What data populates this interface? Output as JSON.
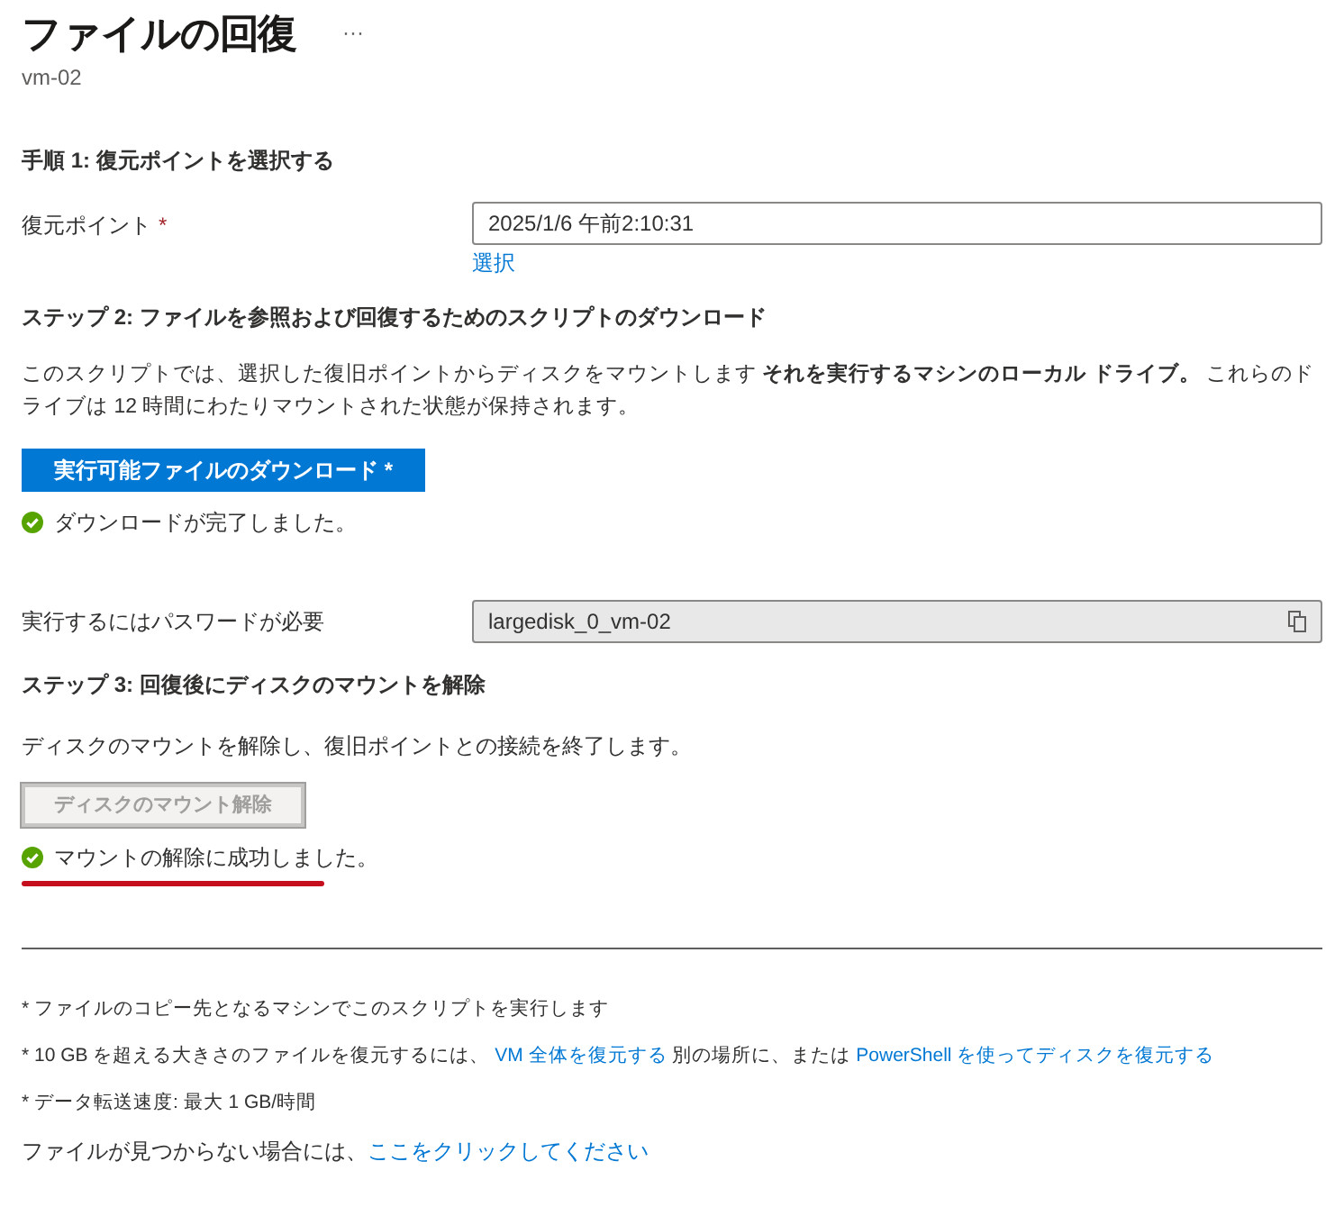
{
  "header": {
    "title": "ファイルの回復",
    "more": "···",
    "subtitle": "vm-02"
  },
  "step1": {
    "heading": "手順 1: 復元ポイントを選択する",
    "field": {
      "label": "復元ポイント",
      "required_mark": "*",
      "value": "2025/1/6 午前2:10:31",
      "link": "選択"
    }
  },
  "step2": {
    "heading": "ステップ 2: ファイルを参照および回復するためのスクリプトのダウンロード",
    "description": "このスクリプトでは、選択した復旧ポイントからディスクをマウントします **それを実行するマシンのローカル ドライブ。** これらのドライブは 12 時間にわたりマウントされた状態が保持されます。",
    "button": {
      "label": "実行可能ファイルのダウンロード *",
      "disabled": false
    },
    "status": {
      "kind": "success",
      "text": "ダウンロードが完了しました。"
    },
    "password": {
      "label": "実行するにはパスワードが必要",
      "value": "largedisk_0_vm-02",
      "read_only": true
    }
  },
  "step3": {
    "heading": "ステップ 3: 回復後にディスクのマウントを解除",
    "description": "ディスクのマウントを解除し、復旧ポイントとの接続を終了します。",
    "button": {
      "label": "ディスクのマウント解除",
      "disabled": true
    },
    "status": {
      "kind": "success",
      "text": "マウントの解除に成功しました。",
      "underlined": true
    }
  },
  "footnotes": [
    {
      "parts": [
        {
          "kind": "text",
          "text": "* ファイルのコピー先となるマシンでこのスクリプトを実行します"
        }
      ]
    },
    {
      "parts": [
        {
          "kind": "text",
          "text": "* 10 GB を超える大きさのファイルを復元するには、"
        },
        {
          "kind": "link",
          "text": "VM 全体を復元する"
        },
        {
          "kind": "text",
          "text": "別の場所に、または"
        },
        {
          "kind": "link",
          "text": "PowerShell を使ってディスクを復元する"
        }
      ]
    },
    {
      "parts": [
        {
          "kind": "text",
          "text": "* データ転送速度: 最大 1 GB/時間"
        }
      ]
    }
  ],
  "help": {
    "text": "ファイルが見つからない場合には、",
    "link": "ここをクリックしてください"
  }
}
